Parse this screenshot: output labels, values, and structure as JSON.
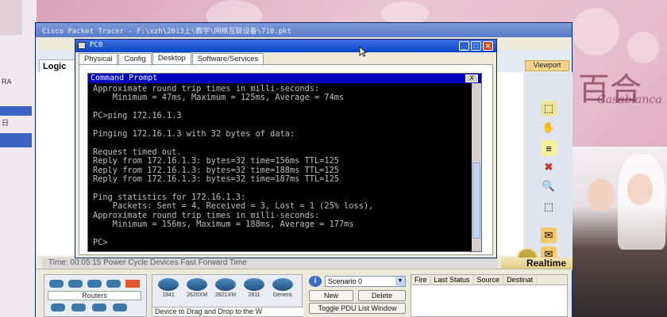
{
  "wallpaper": {
    "brand_text": "百合",
    "brand_subtext": "Casablanca"
  },
  "left_strip": {
    "label_top": "RA",
    "label_mid": "日"
  },
  "pt_window": {
    "title": "Cisco Packet Tracer - F:\\xzh\\2013上\\教学\\网络互联设备\\710.pkt",
    "logical_label": "Logic",
    "viewport_label": "Viewport",
    "time_label": "Time: 00:05:15  Power Cycle Devices  Fast Forward Time",
    "realtime_label": "Realtime"
  },
  "device_panel": {
    "category_label": "Routers",
    "models": [
      "1841",
      "2620XM",
      "2621XM",
      "2811",
      "Generic"
    ],
    "drag_hint": "Device to Drag and Drop to the W"
  },
  "scenario_panel": {
    "selected": "Scenario 0",
    "new_label": "New",
    "delete_label": "Delete",
    "toggle_label": "Toggle PDU List Window"
  },
  "pdu_table": {
    "columns": [
      "Fire",
      "Last Status",
      "Source",
      "Destinat"
    ]
  },
  "pc0": {
    "title": "PC0",
    "tabs": [
      "Physical",
      "Config",
      "Desktop",
      "Software/Services"
    ],
    "active_tab": "Desktop"
  },
  "command_prompt": {
    "title": "Command Prompt",
    "close_label": "X",
    "lines": [
      "Approximate round trip times in milli-seconds:",
      "    Minimum = 47ms, Maximum = 125ms, Average = 74ms",
      "",
      "PC>ping 172.16.1.3",
      "",
      "Pinging 172.16.1.3 with 32 bytes of data:",
      "",
      "Request timed out.",
      "Reply from 172.16.1.3: bytes=32 time=156ms TTL=125",
      "Reply from 172.16.1.3: bytes=32 time=188ms TTL=125",
      "Reply from 172.16.1.3: bytes=32 time=187ms TTL=125",
      "",
      "Ping statistics for 172.16.1.3:",
      "    Packets: Sent = 4, Received = 3, Lost = 1 (25% loss),",
      "Approximate round trip times in milli-seconds:",
      "    Minimum = 156ms, Maximum = 188ms, Average = 177ms",
      "",
      "PC>"
    ]
  }
}
